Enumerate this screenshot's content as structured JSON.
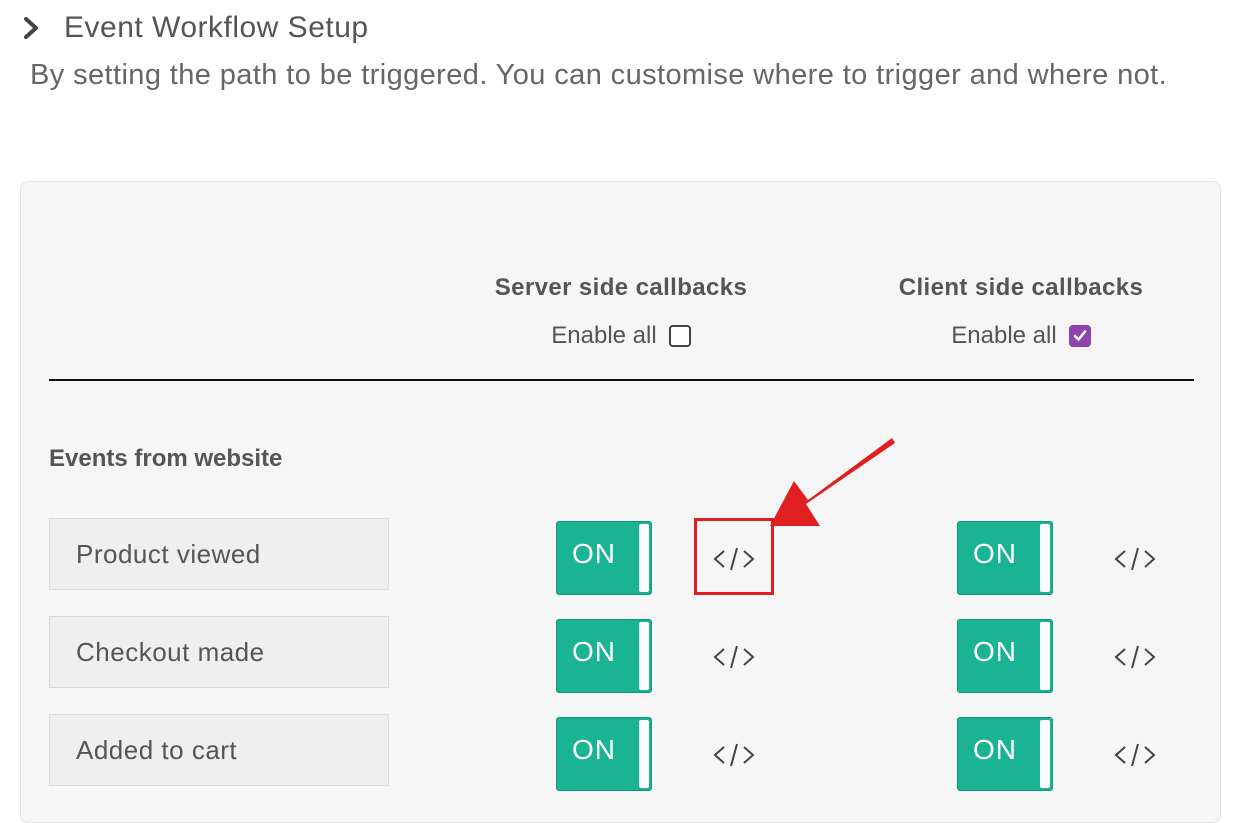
{
  "header": {
    "title": "Event Workflow Setup",
    "icon": "chevron-right-icon",
    "description": "By setting the path to be triggered. You can customise where to trigger and where not."
  },
  "columns": {
    "server": {
      "title": "Server side callbacks",
      "enable_all_label": "Enable all",
      "enable_all_checked": false
    },
    "client": {
      "title": "Client side callbacks",
      "enable_all_label": "Enable all",
      "enable_all_checked": true
    }
  },
  "section": {
    "label": "Events from website"
  },
  "events": [
    {
      "label": "Product viewed",
      "server_toggle": "ON",
      "client_toggle": "ON"
    },
    {
      "label": "Checkout made",
      "server_toggle": "ON",
      "client_toggle": "ON"
    },
    {
      "label": "Added to cart",
      "server_toggle": "ON",
      "client_toggle": "ON"
    }
  ],
  "colors": {
    "toggle_on": "#1ab394",
    "checkbox_checked": "#8e44ad",
    "annotation": "#e02020"
  }
}
